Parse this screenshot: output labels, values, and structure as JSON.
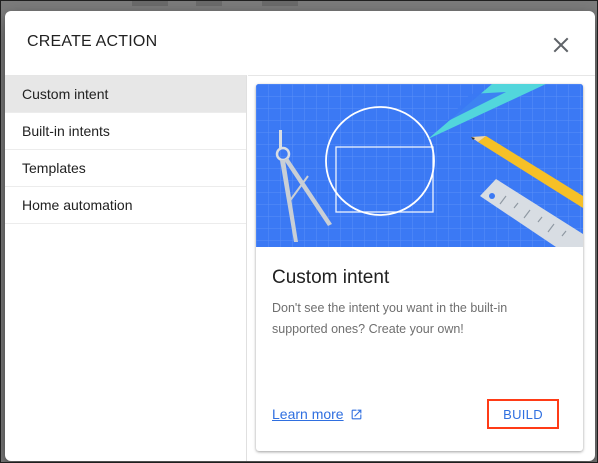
{
  "dialog": {
    "title": "CREATE ACTION"
  },
  "sidebar": {
    "items": [
      {
        "label": "Custom intent",
        "selected": true
      },
      {
        "label": "Built-in intents",
        "selected": false
      },
      {
        "label": "Templates",
        "selected": false
      },
      {
        "label": "Home automation",
        "selected": false
      }
    ]
  },
  "card": {
    "title": "Custom intent",
    "description": "Don't see the intent you want in the built-in supported ones? Create your own!",
    "learn_more_label": "Learn more",
    "build_label": "BUILD"
  },
  "colors": {
    "hero_blue": "#3b79f4",
    "link_blue": "#2f6fe0",
    "highlight_red": "#ff3b16",
    "selected_bg": "#e7e7e7"
  },
  "icons": {
    "close": "close-icon",
    "external_link": "open-in-new-icon"
  }
}
